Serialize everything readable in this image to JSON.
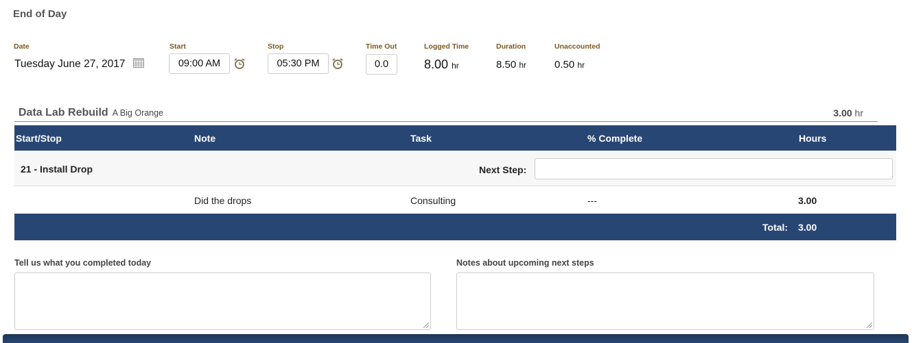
{
  "page": {
    "title": "End of Day"
  },
  "day": {
    "date_label": "Date",
    "date_value": "Tuesday June 27, 2017",
    "start_label": "Start",
    "start_value": "09:00 AM",
    "stop_label": "Stop",
    "stop_value": "05:30 PM",
    "timeout_label": "Time Out",
    "timeout_value": "0.0",
    "logged_label": "Logged Time",
    "logged_value": "8.00",
    "duration_label": "Duration",
    "duration_value": "8.50",
    "unaccounted_label": "Unaccounted",
    "unaccounted_value": "0.50",
    "unit": "hr",
    "icons": {
      "date": "calendar-icon",
      "start": "alarm-clock-icon",
      "stop": "alarm-clock-icon"
    }
  },
  "project": {
    "name": "Data Lab Rebuild",
    "client": "A Big Orange",
    "hours": "3.00",
    "unit": "hr"
  },
  "table": {
    "headers": [
      "Start/Stop",
      "Note",
      "Task",
      "% Complete",
      "Hours"
    ],
    "group": {
      "title": "21 - Install Drop",
      "next_step_label": "Next Step:",
      "next_step_value": ""
    },
    "rows": [
      {
        "start_stop": "",
        "note": "Did the drops",
        "task": "Consulting",
        "complete": "---",
        "hours": "3.00"
      }
    ],
    "total_label": "Total:",
    "total_value": "3.00"
  },
  "notes": {
    "completed_label": "Tell us what you completed today",
    "completed_value": "",
    "next_label": "Notes about upcoming next steps",
    "next_value": ""
  },
  "colors": {
    "header": "#284673",
    "label": "#7a5a1e"
  }
}
